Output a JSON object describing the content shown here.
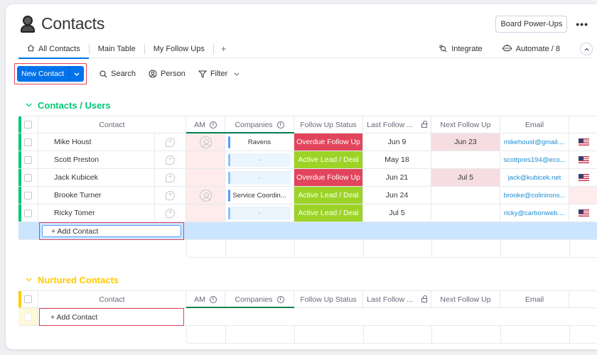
{
  "header": {
    "title": "Contacts",
    "title_icon": "person-icon",
    "power_ups_label": "Board Power-Ups",
    "more_label": "•••"
  },
  "tabs": {
    "items": [
      {
        "label": "All Contacts",
        "icon": "home-icon",
        "active": true
      },
      {
        "label": "Main Table",
        "active": false
      },
      {
        "label": "My Follow Ups",
        "active": false
      }
    ],
    "add_label": "+",
    "integrate_label": "Integrate",
    "automate_label": "Automate / 8",
    "collapse_label": "^"
  },
  "toolbar": {
    "new_label": "New Contact",
    "search_label": "Search",
    "person_label": "Person",
    "filter_label": "Filter"
  },
  "columns": {
    "contact": "Contact",
    "am": "AM",
    "companies": "Companies",
    "status": "Follow Up Status",
    "last": "Last Follow ...",
    "next": "Next Follow Up",
    "email": "Email"
  },
  "colors": {
    "accent": "#0073ea",
    "overdue": "#e2445c",
    "active": "#9cd326",
    "group_users": "#00c875",
    "group_nurtured": "#ffcb00"
  },
  "groups": [
    {
      "title": "Contacts / Users",
      "color": "#00c875",
      "add_label": "+ Add Contact",
      "rows": [
        {
          "contact": "Mike Houst",
          "am_avatar": true,
          "company": "Ravens",
          "status": "Overdue Follow Up",
          "status_type": "overdue",
          "last": "Jun 9",
          "next": "Jun 23",
          "email": "mikehoust@gmail....",
          "flag": true
        },
        {
          "contact": "Scott Preston",
          "am_avatar": false,
          "company": "-",
          "status": "Active Lead / Deal",
          "status_type": "active",
          "last": "May 18",
          "next": "",
          "email": "scottpres194@eco...",
          "flag": true
        },
        {
          "contact": "Jack Kubicek",
          "am_avatar": false,
          "company": "-",
          "status": "Overdue Follow Up",
          "status_type": "overdue",
          "last": "Jun 21",
          "next": "Jul 5",
          "email": "jack@kubicek.net",
          "flag": true
        },
        {
          "contact": "Brooke Turner",
          "am_avatar": true,
          "company": "Service Coordin...",
          "status": "Active Lead / Deal",
          "status_type": "active",
          "last": "Jun 24",
          "next": "",
          "email": "brooke@colinirons...",
          "flag": false
        },
        {
          "contact": "Ricky Tomer",
          "am_avatar": false,
          "company": "-",
          "status": "Active Lead / Deal",
          "status_type": "active",
          "last": "Jul 5",
          "next": "",
          "email": "ricky@carbonweb....",
          "flag": true
        }
      ]
    },
    {
      "title": "Nurtured Contacts",
      "color": "#ffcb00",
      "add_label": "+ Add Contact",
      "rows": []
    }
  ]
}
